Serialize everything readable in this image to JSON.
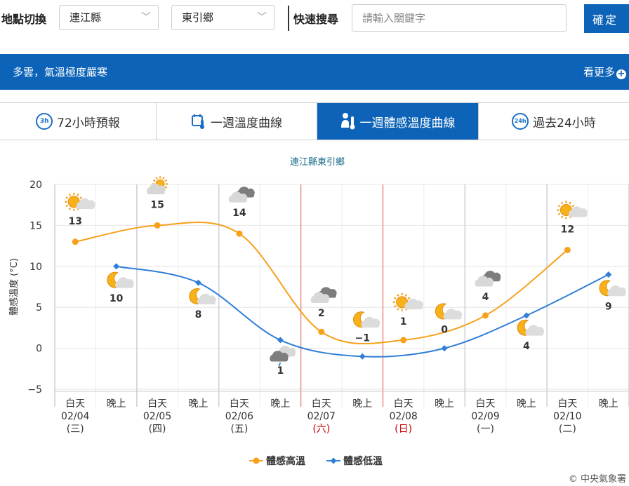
{
  "header": {
    "location_label": "地點切換",
    "county": "連江縣",
    "township": "東引鄉",
    "search_label": "快速搜尋",
    "search_placeholder": "請輸入關鍵字",
    "confirm_label": "確定"
  },
  "banner": {
    "text": "多雲，氣溫極度嚴寒",
    "more_label": "看更多"
  },
  "tabs": [
    {
      "icon": "3h",
      "label": "72小時預報"
    },
    {
      "icon": "thermometer-calendar",
      "label": "一週溫度曲線"
    },
    {
      "icon": "person-thermometer",
      "label": "一週體感溫度曲線"
    },
    {
      "icon": "24h",
      "label": "過去24小時"
    }
  ],
  "colors": {
    "accent": "#0d63b7",
    "high_series": "#f7a11a",
    "low_series": "#2f7ed8"
  },
  "copyright": "© 中央氣象署",
  "chart_data": {
    "type": "line",
    "title": "連江縣東引鄉",
    "ylabel": "體感溫度 (°C)",
    "ylim": [
      -5,
      20
    ],
    "yticks": [
      "20",
      "15",
      "10",
      "5",
      "0",
      "−5"
    ],
    "x": [
      {
        "period": "白天",
        "date": "02/04",
        "weekday": "(三)"
      },
      {
        "period": "晚上"
      },
      {
        "period": "白天",
        "date": "02/05",
        "weekday": "(四)"
      },
      {
        "period": "晚上"
      },
      {
        "period": "白天",
        "date": "02/06",
        "weekday": "(五)"
      },
      {
        "period": "晚上"
      },
      {
        "period": "白天",
        "date": "02/07",
        "weekday": "(六)",
        "holiday": true
      },
      {
        "period": "晚上"
      },
      {
        "period": "白天",
        "date": "02/08",
        "weekday": "(日)",
        "holiday": true
      },
      {
        "period": "晚上"
      },
      {
        "period": "白天",
        "date": "02/09",
        "weekday": "(一)"
      },
      {
        "period": "晚上"
      },
      {
        "period": "白天",
        "date": "02/10",
        "weekday": "(二)"
      },
      {
        "period": "晚上"
      }
    ],
    "weather_icons": [
      "sunny-cloud",
      "moon-cloud",
      "partly-cloudy",
      "moon-cloud",
      "cloudy",
      "rain-cloud",
      "cloudy",
      "moon-cloud",
      "sunny-cloud",
      "moon-cloud",
      "cloudy",
      "moon-cloud",
      "sunny-cloud",
      "moon-cloud"
    ],
    "series": [
      {
        "name": "體感高溫",
        "x_index": [
          0,
          2,
          4,
          6,
          8,
          10,
          12
        ],
        "values": [
          13,
          15,
          14,
          2,
          1,
          4,
          12
        ]
      },
      {
        "name": "體感低溫",
        "x_index": [
          1,
          3,
          5,
          7,
          9,
          11,
          13
        ],
        "values": [
          10,
          8,
          1,
          -1,
          0,
          4,
          9
        ]
      }
    ],
    "legend": "bottom-center"
  }
}
